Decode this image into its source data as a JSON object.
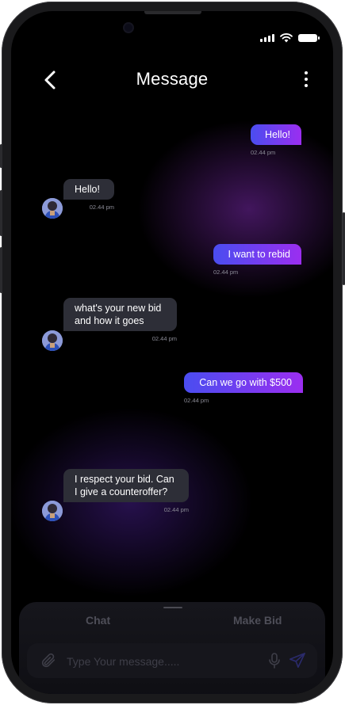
{
  "header": {
    "title": "Message"
  },
  "messages": [
    {
      "side": "sent",
      "text": "Hello!",
      "time": "02.44 pm"
    },
    {
      "side": "received",
      "text": "Hello!",
      "time": "02.44 pm"
    },
    {
      "side": "sent",
      "text": "I want to rebid",
      "time": "02.44 pm"
    },
    {
      "side": "received",
      "lines": [
        "what's your new bid",
        "and how it goes"
      ],
      "time": "02.44 pm"
    },
    {
      "side": "sent",
      "text": "Can we go with $500",
      "time": "02.44 pm"
    },
    {
      "side": "received",
      "lines": [
        "I respect your bid. Can",
        "I give a counteroffer?"
      ],
      "time": "02.44 pm"
    }
  ],
  "tabs": {
    "chat": "Chat",
    "make_bid": "Make Bid"
  },
  "composer": {
    "placeholder": "Type Your message....."
  },
  "colors": {
    "sent_start": "#4a4df0",
    "sent_end": "#9b2ef0",
    "received_bg": "#2d2e37",
    "background": "#000000"
  },
  "icons": [
    "back-arrow-icon",
    "more-vertical-icon",
    "signal-icon",
    "wifi-icon",
    "battery-icon",
    "attachment-icon",
    "microphone-icon",
    "send-icon"
  ]
}
